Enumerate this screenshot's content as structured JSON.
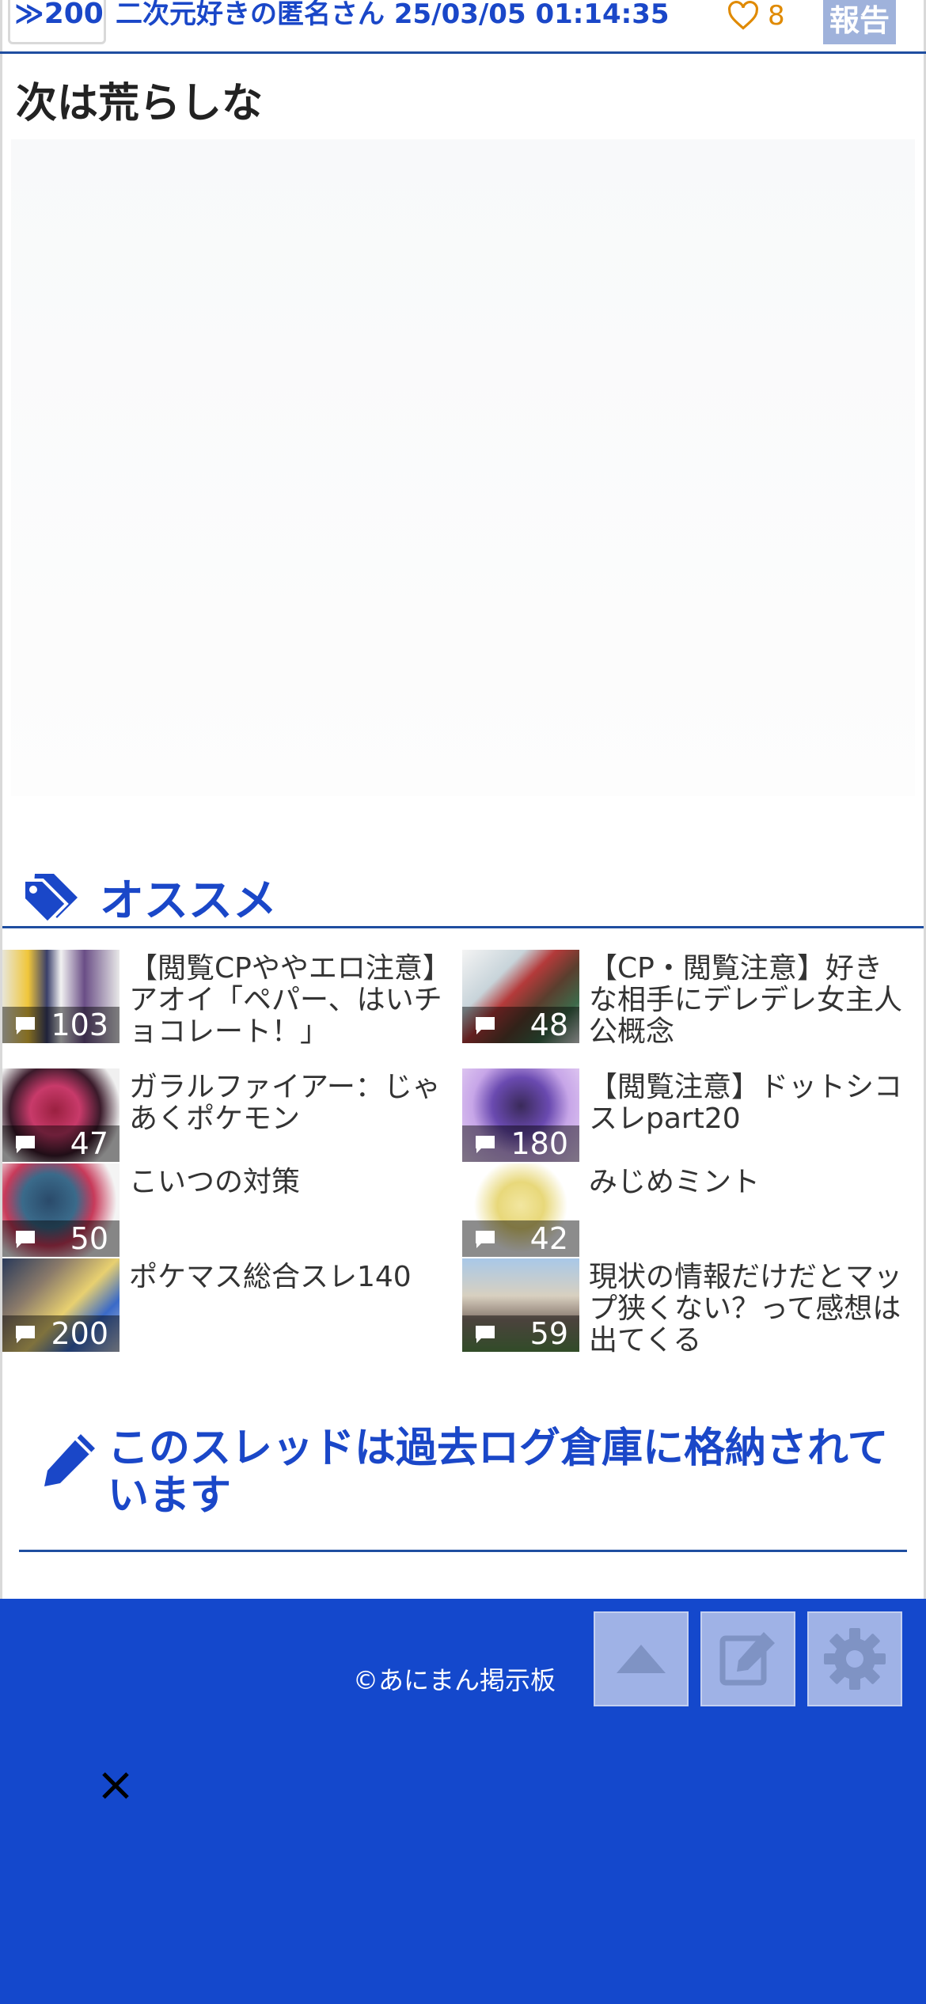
{
  "post": {
    "anchor": "≫200",
    "meta": "二次元好きの匿名さん 25/03/05 01:14:35",
    "likes": "8",
    "report_label": "報告",
    "body": "次は荒らしな"
  },
  "recommend": {
    "title": "オススメ",
    "items": [
      {
        "title": "【閲覧CPややエロ注意】アオイ「ペパー、はいチョコレート！」",
        "count": "103"
      },
      {
        "title": "【CP・閲覧注意】好きな相手にデレデレ女主人公概念",
        "count": "48"
      },
      {
        "title": "ガラルファイアー：じゃあくポケモン",
        "count": "47"
      },
      {
        "title": "【閲覧注意】ドットシコスレpart20",
        "count": "180"
      },
      {
        "title": "こいつの対策",
        "count": "50"
      },
      {
        "title": "みじめミント",
        "count": "42"
      },
      {
        "title": "ポケマス総合スレ140",
        "count": "200"
      },
      {
        "title": "現状の情報だけだとマップ狭くない？って感想は出てくる",
        "count": "59"
      }
    ]
  },
  "archive": {
    "text": "このスレッドは過去ログ倉庫に格納されています"
  },
  "footer": {
    "copyright": "©あにまん掲示板",
    "buttons": [
      "scroll-top-icon",
      "edit-icon",
      "gear-icon"
    ],
    "close_icon": "close-icon"
  },
  "colors": {
    "accent": "#1a47c8",
    "footer_bg": "#1448cc",
    "like": "#e08a00"
  }
}
